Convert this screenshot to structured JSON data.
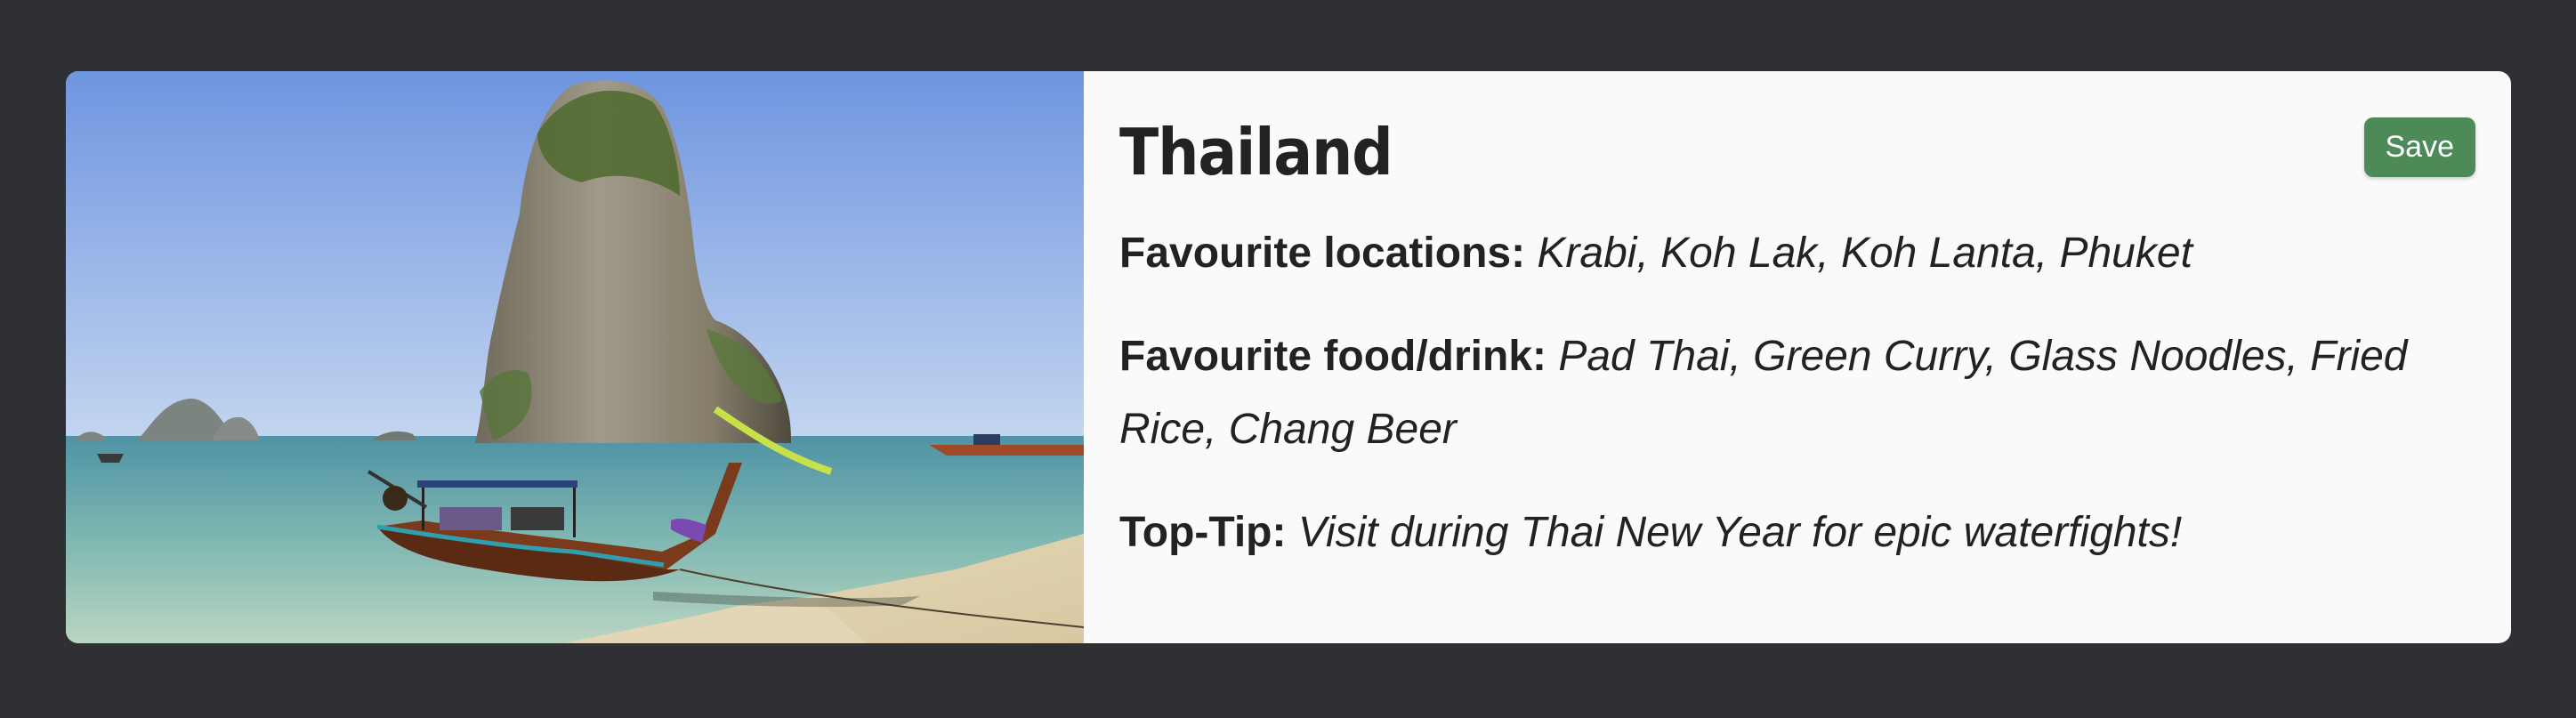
{
  "card": {
    "title": "Thailand",
    "save_label": "Save",
    "image_alt": "Longtail boat on a beach in front of a limestone karst",
    "details": [
      {
        "label": "Favourite locations:",
        "value": "Krabi, Koh Lak, Koh Lanta, Phuket"
      },
      {
        "label": "Favourite food/drink:",
        "value": "Pad Thai, Green Curry, Glass Noodles, Fried Rice, Chang Beer"
      },
      {
        "label": "Top-Tip:",
        "value": "Visit during Thai New Year for epic waterfights!"
      }
    ]
  },
  "colors": {
    "page_background": "#2f3033",
    "card_background": "#fafafa",
    "save_button": "#4e8a57"
  }
}
